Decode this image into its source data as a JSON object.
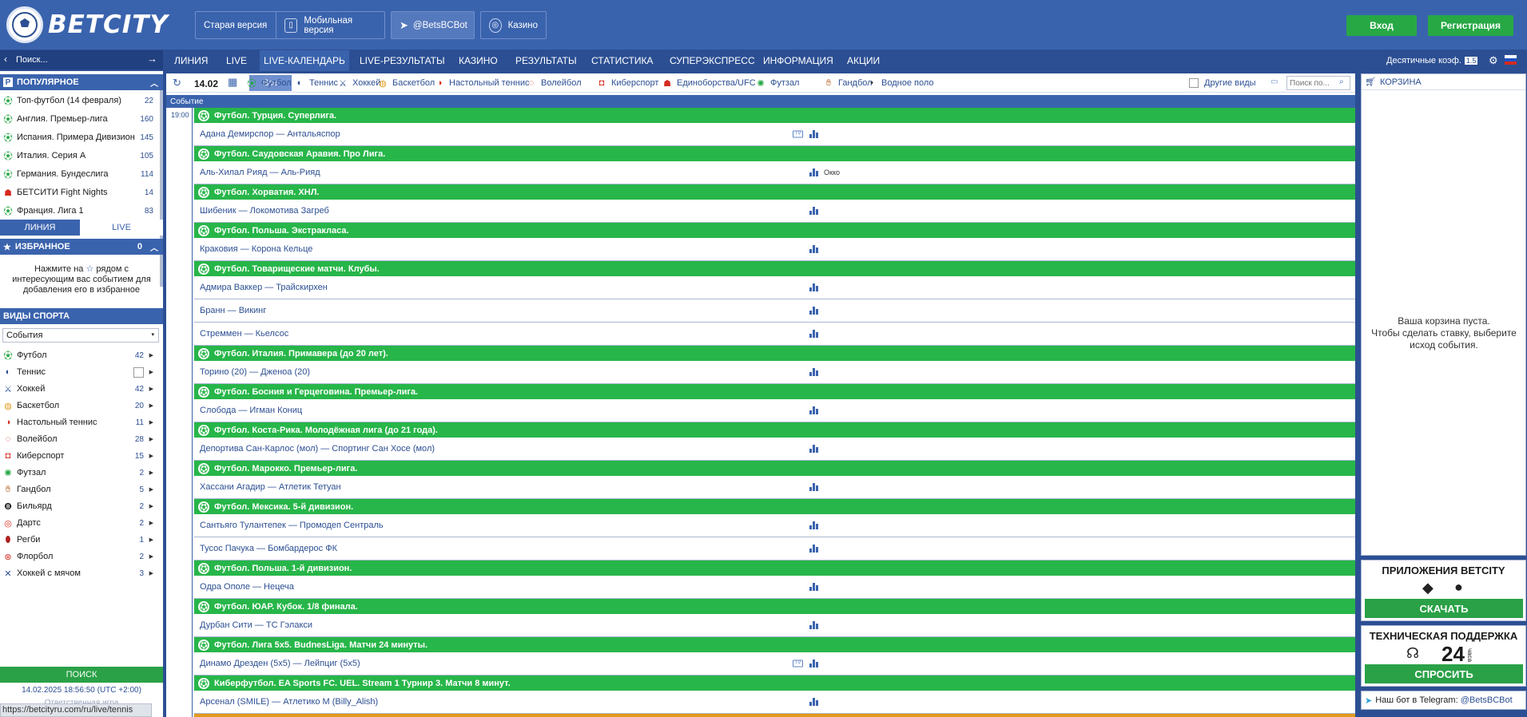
{
  "brand": {
    "logo_text": "BETCITY"
  },
  "header": {
    "old_version": "Старая версия",
    "mobile_version": "Мобильная версия",
    "telegram_bot": "@BetsBCBot",
    "casino": "Казино",
    "login": "Вход",
    "register": "Регистрация"
  },
  "nav": {
    "search_placeholder": "Поиск...",
    "items": [
      "ЛИНИЯ",
      "LIVE",
      "LIVE-КАЛЕНДАРЬ",
      "LIVE-РЕЗУЛЬТАТЫ",
      "КАЗИНО",
      "РЕЗУЛЬТАТЫ",
      "СТАТИСТИКА",
      "СУПЕРЭКСПРЕСС",
      "ИНФОРМАЦИЯ",
      "АКЦИИ"
    ],
    "active_index": 2,
    "odds_format": "Десятичные коэф.",
    "odds_badge": "1.5"
  },
  "sidebar": {
    "popular_title": "ПОПУЛЯРНОЕ",
    "popular": [
      {
        "label": "Топ-футбол (14 февраля)",
        "count": "22",
        "icon": "soccer-ball-icon"
      },
      {
        "label": "Англия. Премьер-лига",
        "count": "160",
        "icon": "soccer-ball-icon"
      },
      {
        "label": "Испания. Примера Дивизион",
        "count": "145",
        "icon": "soccer-ball-icon"
      },
      {
        "label": "Италия. Серия А",
        "count": "105",
        "icon": "soccer-ball-icon"
      },
      {
        "label": "Германия. Бундеслига",
        "count": "114",
        "icon": "soccer-ball-icon"
      },
      {
        "label": "БЕТСИТИ Fight Nights",
        "count": "14",
        "icon": "fight-icon"
      },
      {
        "label": "Франция. Лига 1",
        "count": "83",
        "icon": "soccer-ball-icon"
      }
    ],
    "tabs": [
      "ЛИНИЯ",
      "LIVE"
    ],
    "favorites_title": "ИЗБРАННОЕ",
    "favorites_count": "0",
    "favorites_hint_1": "Нажмите на",
    "favorites_hint_2": "рядом с интересующим вас событием для добавления его в избранное",
    "sports_title": "ВИДЫ СПОРТА",
    "sports_select": "События",
    "sports": [
      {
        "label": "Футбол",
        "count": "42",
        "icon": "soccer-ball-icon"
      },
      {
        "label": "Теннис",
        "count": "",
        "icon": "tennis-ball-icon"
      },
      {
        "label": "Хоккей",
        "count": "42",
        "icon": "hockey-sticks-icon"
      },
      {
        "label": "Баскетбол",
        "count": "20",
        "icon": "basketball-icon"
      },
      {
        "label": "Настольный теннис",
        "count": "11",
        "icon": "table-tennis-icon"
      },
      {
        "label": "Волейбол",
        "count": "28",
        "icon": "volleyball-icon"
      },
      {
        "label": "Киберспорт",
        "count": "15",
        "icon": "gamepad-icon"
      },
      {
        "label": "Футзал",
        "count": "2",
        "icon": "futsal-ball-icon"
      },
      {
        "label": "Гандбол",
        "count": "5",
        "icon": "handball-icon"
      },
      {
        "label": "Бильярд",
        "count": "2",
        "icon": "billiard-ball-icon"
      },
      {
        "label": "Дартс",
        "count": "2",
        "icon": "darts-icon"
      },
      {
        "label": "Регби",
        "count": "1",
        "icon": "rugby-ball-icon"
      },
      {
        "label": "Флорбол",
        "count": "2",
        "icon": "floorball-icon"
      },
      {
        "label": "Хоккей с мячом",
        "count": "3",
        "icon": "bandy-icon"
      }
    ],
    "responsible_btn": "ПОИСК",
    "datetime": "14.02.2025 18:56:50 (UTC +2:00)",
    "responsible_game": "Ответственная игра"
  },
  "filters": {
    "date": "14.02",
    "all": "Все",
    "sports": [
      "Футбол",
      "Теннис",
      "Хоккей",
      "Баскетбол",
      "Настольный теннис",
      "Волейбол",
      "Киберспорт",
      "Единоборства/UFC",
      "Футзал",
      "Гандбол",
      "Водное поло"
    ],
    "other_types": "Другие виды",
    "search_placeholder": "Поиск по..."
  },
  "table": {
    "column_event": "Событие",
    "time": "19:00",
    "leagues": [
      {
        "name": "Футбол. Турция. Суперлига.",
        "matches": [
          {
            "name": "Адана Демирспор — Антальяспор",
            "tv": true
          }
        ]
      },
      {
        "name": "Футбол. Саудовская Аравия. Про Лига.",
        "matches": [
          {
            "name": "Аль-Хилал Рияд — Аль-Рияд",
            "okko": "Окко"
          }
        ]
      },
      {
        "name": "Футбол. Хорватия. ХНЛ.",
        "matches": [
          {
            "name": "Шибеник — Локомотива Загреб"
          }
        ]
      },
      {
        "name": "Футбол. Польша. Экстракласа.",
        "matches": [
          {
            "name": "Краковия — Корона Кельце"
          }
        ]
      },
      {
        "name": "Футбол. Товарищеские матчи. Клубы.",
        "matches": [
          {
            "name": "Адмира Ваккер — Трайскирхен"
          },
          {
            "name": "Бранн — Викинг"
          },
          {
            "name": "Стреммен — Кьелсос"
          }
        ]
      },
      {
        "name": "Футбол. Италия. Примавера (до 20 лет).",
        "matches": [
          {
            "name": "Торино (20) — Дженоа (20)"
          }
        ]
      },
      {
        "name": "Футбол. Босния и Герцеговина. Премьер-лига.",
        "matches": [
          {
            "name": "Слобода — Игман Кониц"
          }
        ]
      },
      {
        "name": "Футбол. Коста-Рика. Молодёжная лига (до 21 года).",
        "matches": [
          {
            "name": "Депортива Сан-Карлос (мол) — Спортинг Сан Хосе (мол)"
          }
        ]
      },
      {
        "name": "Футбол. Марокко. Премьер-лига.",
        "matches": [
          {
            "name": "Хассани Агадир — Атлетик Тетуан"
          }
        ]
      },
      {
        "name": "Футбол. Мексика. 5-й дивизион.",
        "matches": [
          {
            "name": "Сантьяго Тулантепек — Промодеп Сентраль"
          },
          {
            "name": "Тусос Пачука — Бомбардерос ФК"
          }
        ]
      },
      {
        "name": "Футбол. Польша. 1-й дивизион.",
        "matches": [
          {
            "name": "Одра Ополе — Нецеча"
          }
        ]
      },
      {
        "name": "Футбол. ЮАР. Кубок. 1/8 финала.",
        "matches": [
          {
            "name": "Дурбан Сити — ТС Гэлакси"
          }
        ]
      },
      {
        "name": "Футбол. Лига 5х5. BudnesLiga. Матчи 24 минуты.",
        "matches": [
          {
            "name": "Динамо Дрезден (5x5) — Лейпциг (5x5)",
            "tv": true
          }
        ]
      },
      {
        "name": "Киберфутбол. EA Sports FC. UEL. Stream 1 Турнир 3. Матчи 8 минут.",
        "matches": [
          {
            "name": "Арсенал (SMILE) — Атлетико М (Billy_Alish)"
          }
        ]
      }
    ]
  },
  "cart": {
    "title": "КОРЗИНА",
    "empty_1": "Ваша корзина пуста.",
    "empty_2": "Чтобы сделать ставку, выберите исход события."
  },
  "apps": {
    "title": "ПРИЛОЖЕНИЯ BETCITY",
    "download": "СКАЧАТЬ"
  },
  "support": {
    "title": "ТЕХНИЧЕСКАЯ ПОДДЕРЖКА",
    "hours": "24",
    "hours_unit": "часа",
    "ask": "СПРОСИТЬ"
  },
  "telegram_footer": {
    "label": "Наш бот в Telegram:",
    "bot": "@BetsBCBot"
  },
  "status_url": "https://betcityru.com/ru/live/tennis"
}
